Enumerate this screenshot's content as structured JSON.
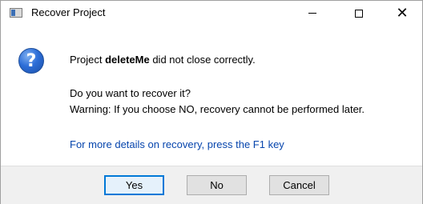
{
  "window": {
    "title": "Recover Project",
    "controls": {
      "minimize_icon": "minimize-icon",
      "maximize_icon": "maximize-icon",
      "close_glyph": "✕"
    }
  },
  "message": {
    "icon": "question-icon",
    "icon_glyph": "?",
    "line1_prefix": "Project ",
    "line1_project": "deleteMe",
    "line1_suffix": " did not close correctly.",
    "line2": "Do you want to recover it?",
    "line3": "Warning: If you choose NO, recovery cannot be performed later.",
    "help_link": "For more details on recovery, press the F1 key"
  },
  "buttons": {
    "yes": "Yes",
    "no": "No",
    "cancel": "Cancel"
  },
  "colors": {
    "link": "#0645ad",
    "default_button_border": "#0078d7",
    "footer_bg": "#f0f0f0"
  }
}
